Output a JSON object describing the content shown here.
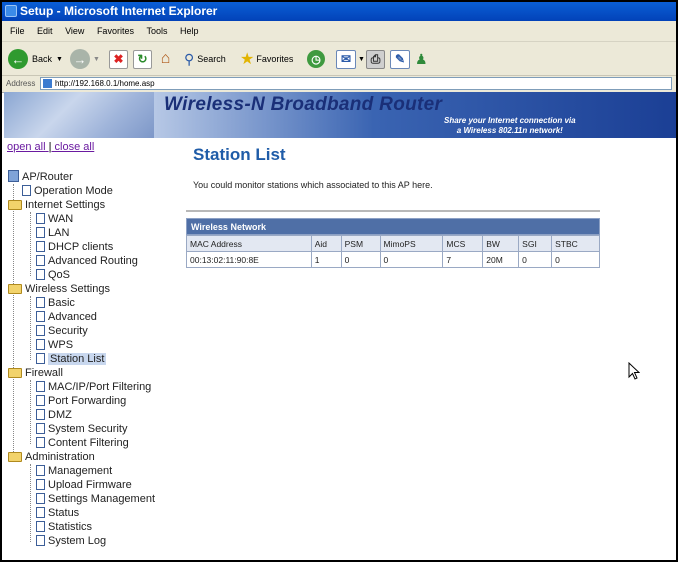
{
  "window": {
    "title": "Setup - Microsoft Internet Explorer"
  },
  "menu": [
    "File",
    "Edit",
    "View",
    "Favorites",
    "Tools",
    "Help"
  ],
  "toolbar": {
    "back": "Back",
    "search": "Search",
    "favorites": "Favorites"
  },
  "address": {
    "label": "Address",
    "url": "http://192.168.0.1/home.asp"
  },
  "banner": {
    "title": "Wireless-N Broadband Router",
    "tagline_line1": "Share your Internet connection via",
    "tagline_line2": "a Wireless 802.11n network!"
  },
  "sidebar": {
    "open_all": "open all",
    "close_all": "close all",
    "separator": "|",
    "root": "AP/Router",
    "operation_mode": "Operation Mode",
    "internet_settings": "Internet Settings",
    "internet_items": [
      "WAN",
      "LAN",
      "DHCP clients",
      "Advanced Routing",
      "QoS"
    ],
    "wireless_settings": "Wireless Settings",
    "wireless_items": [
      "Basic",
      "Advanced",
      "Security",
      "WPS",
      "Station List"
    ],
    "firewall": "Firewall",
    "firewall_items": [
      "MAC/IP/Port Filtering",
      "Port Forwarding",
      "DMZ",
      "System Security",
      "Content Filtering"
    ],
    "administration": "Administration",
    "admin_items": [
      "Management",
      "Upload Firmware",
      "Settings Management",
      "Status",
      "Statistics",
      "System Log"
    ]
  },
  "main": {
    "title": "Station List",
    "description": "You could monitor stations which associated to this AP here.",
    "table_caption": "Wireless Network",
    "columns": [
      "MAC Address",
      "Aid",
      "PSM",
      "MimoPS",
      "MCS",
      "BW",
      "SGI",
      "STBC"
    ],
    "rows": [
      [
        "00:13:02:11:90:8E",
        "1",
        "0",
        "0",
        "7",
        "20M",
        "0",
        "0"
      ]
    ]
  }
}
